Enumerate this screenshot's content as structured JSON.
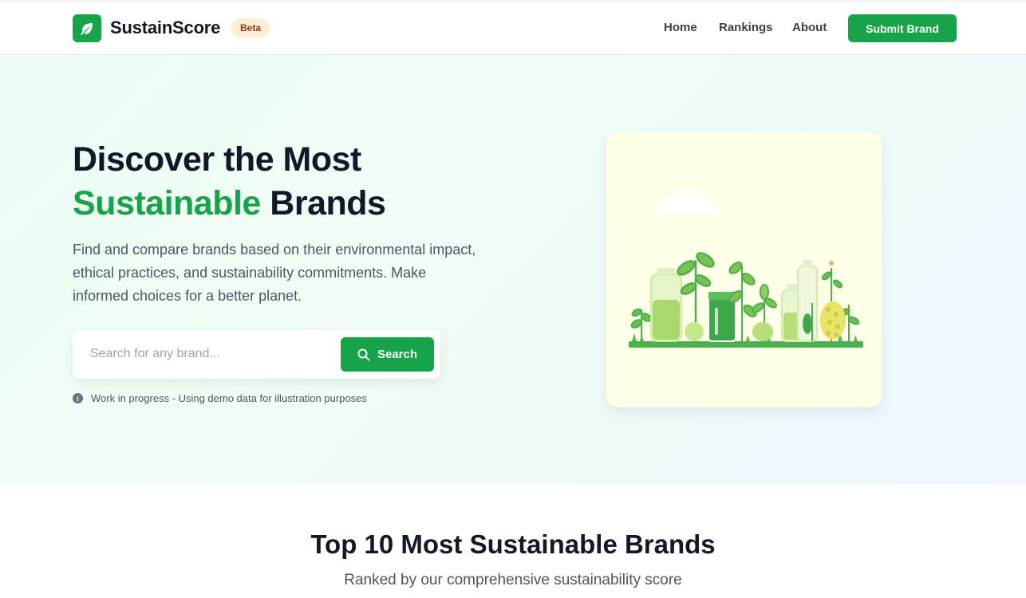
{
  "header": {
    "brand": "SustainScore",
    "badge": "Beta",
    "nav": {
      "home": "Home",
      "rankings": "Rankings",
      "about": "About",
      "submit": "Submit Brand"
    }
  },
  "hero": {
    "title_line1": "Discover the Most",
    "title_highlight": "Sustainable",
    "title_line2_rest": " Brands",
    "description": "Find and compare brands based on their environmental impact, ethical practices, and sustainability commitments. Make informed choices for a better planet.",
    "search": {
      "placeholder": "Search for any brand...",
      "value": "",
      "button_label": "Search"
    },
    "notice": "Work in progress - Using demo data for illustration purposes"
  },
  "rankings_section": {
    "title": "Top 10 Most Sustainable Brands",
    "subtitle": "Ranked by our comprehensive sustainability score"
  },
  "colors": {
    "accent": "#16a34a",
    "badge_bg": "#ffedd5",
    "badge_text": "#9a3412",
    "heading": "#111827",
    "body_text": "#4b5563"
  },
  "icons": {
    "logo": "leaf-icon",
    "search": "search-icon",
    "notice": "info-icon"
  }
}
